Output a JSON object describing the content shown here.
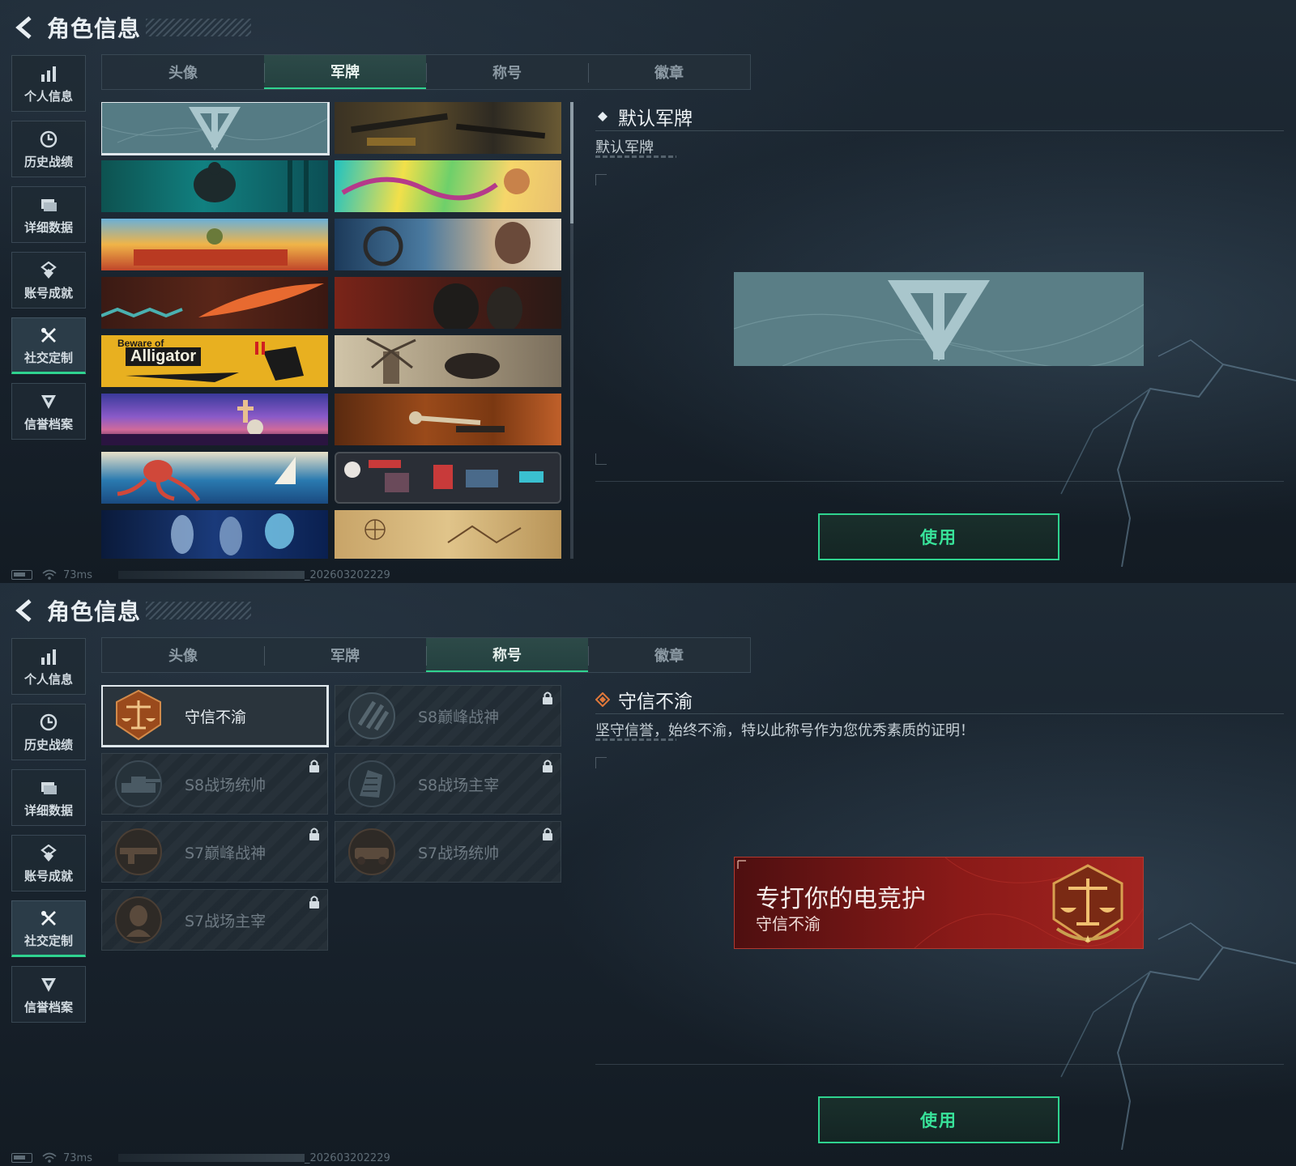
{
  "colors": {
    "accent_green": "#2fd38f",
    "use_text": "#38e39a",
    "title_red": "#8a1a18",
    "plate_teal": "#557b84"
  },
  "screens": [
    {
      "header": {
        "title": "角色信息",
        "back_icon": "chevron-left-icon"
      },
      "sidebar": [
        {
          "label": "个人信息",
          "icon": "bar-chart-icon",
          "active": false
        },
        {
          "label": "历史战绩",
          "icon": "clock-icon",
          "active": false
        },
        {
          "label": "详细数据",
          "icon": "folder-icon",
          "active": false
        },
        {
          "label": "账号成就",
          "icon": "medal-icon",
          "active": false
        },
        {
          "label": "社交定制",
          "icon": "tools-icon",
          "active": true
        },
        {
          "label": "信誉档案",
          "icon": "shield-badge-icon",
          "active": false
        }
      ],
      "tabs": [
        {
          "label": "头像",
          "active": false
        },
        {
          "label": "军牌",
          "active": true
        },
        {
          "label": "称号",
          "active": false
        },
        {
          "label": "徽章",
          "active": false
        }
      ],
      "plates": [
        {
          "id": "default",
          "selected": true
        },
        {
          "id": "weapons-table"
        },
        {
          "id": "gym-teal"
        },
        {
          "id": "music-pop"
        },
        {
          "id": "market-stall"
        },
        {
          "id": "mechanic-woman"
        },
        {
          "id": "tribal-feather"
        },
        {
          "id": "soldiers-red"
        },
        {
          "id": "alligator",
          "text_small": "Beware of",
          "text_big": "Alligator"
        },
        {
          "id": "windmill-knight"
        },
        {
          "id": "halloween-graves"
        },
        {
          "id": "autumn-skeleton"
        },
        {
          "id": "octopus-waves"
        },
        {
          "id": "pixel-game"
        },
        {
          "id": "xray-galaxy"
        },
        {
          "id": "sketch-map"
        }
      ],
      "detail": {
        "name": "默认军牌",
        "desc": "默认军牌",
        "icon": "diamond-icon"
      },
      "use_label": "使用",
      "status": {
        "ping": "73ms",
        "build": "_202603202229"
      }
    },
    {
      "header": {
        "title": "角色信息",
        "back_icon": "chevron-left-icon"
      },
      "sidebar": [
        {
          "label": "个人信息",
          "icon": "bar-chart-icon",
          "active": false
        },
        {
          "label": "历史战绩",
          "icon": "clock-icon",
          "active": false
        },
        {
          "label": "详细数据",
          "icon": "folder-icon",
          "active": false
        },
        {
          "label": "账号成就",
          "icon": "medal-icon",
          "active": false
        },
        {
          "label": "社交定制",
          "icon": "tools-icon",
          "active": true
        },
        {
          "label": "信誉档案",
          "icon": "shield-badge-icon",
          "active": false
        }
      ],
      "tabs": [
        {
          "label": "头像",
          "active": false
        },
        {
          "label": "军牌",
          "active": false
        },
        {
          "label": "称号",
          "active": true
        },
        {
          "label": "徽章",
          "active": false
        }
      ],
      "titles": [
        {
          "name": "守信不渝",
          "locked": false,
          "selected": true,
          "emblem": "scales-emblem"
        },
        {
          "name": "S8巅峰战神",
          "locked": true,
          "emblem": "stripes-emblem"
        },
        {
          "name": "S8战场统帅",
          "locked": true,
          "emblem": "tank-emblem"
        },
        {
          "name": "S8战场主宰",
          "locked": true,
          "emblem": "building-emblem"
        },
        {
          "name": "S7巅峰战神",
          "locked": true,
          "emblem": "gun-emblem"
        },
        {
          "name": "S7战场统帅",
          "locked": true,
          "emblem": "vehicle-emblem"
        },
        {
          "name": "S7战场主宰",
          "locked": true,
          "emblem": "soldier-emblem"
        }
      ],
      "detail": {
        "name": "守信不渝",
        "desc": "坚守信誉，始终不渝，特以此称号作为您优秀素质的证明！",
        "icon": "orange-diamond-icon"
      },
      "preview": {
        "main": "专打你的电竞护",
        "sub": "守信不渝"
      },
      "use_label": "使用",
      "status": {
        "ping": "73ms",
        "build": "_202603202229"
      }
    }
  ]
}
